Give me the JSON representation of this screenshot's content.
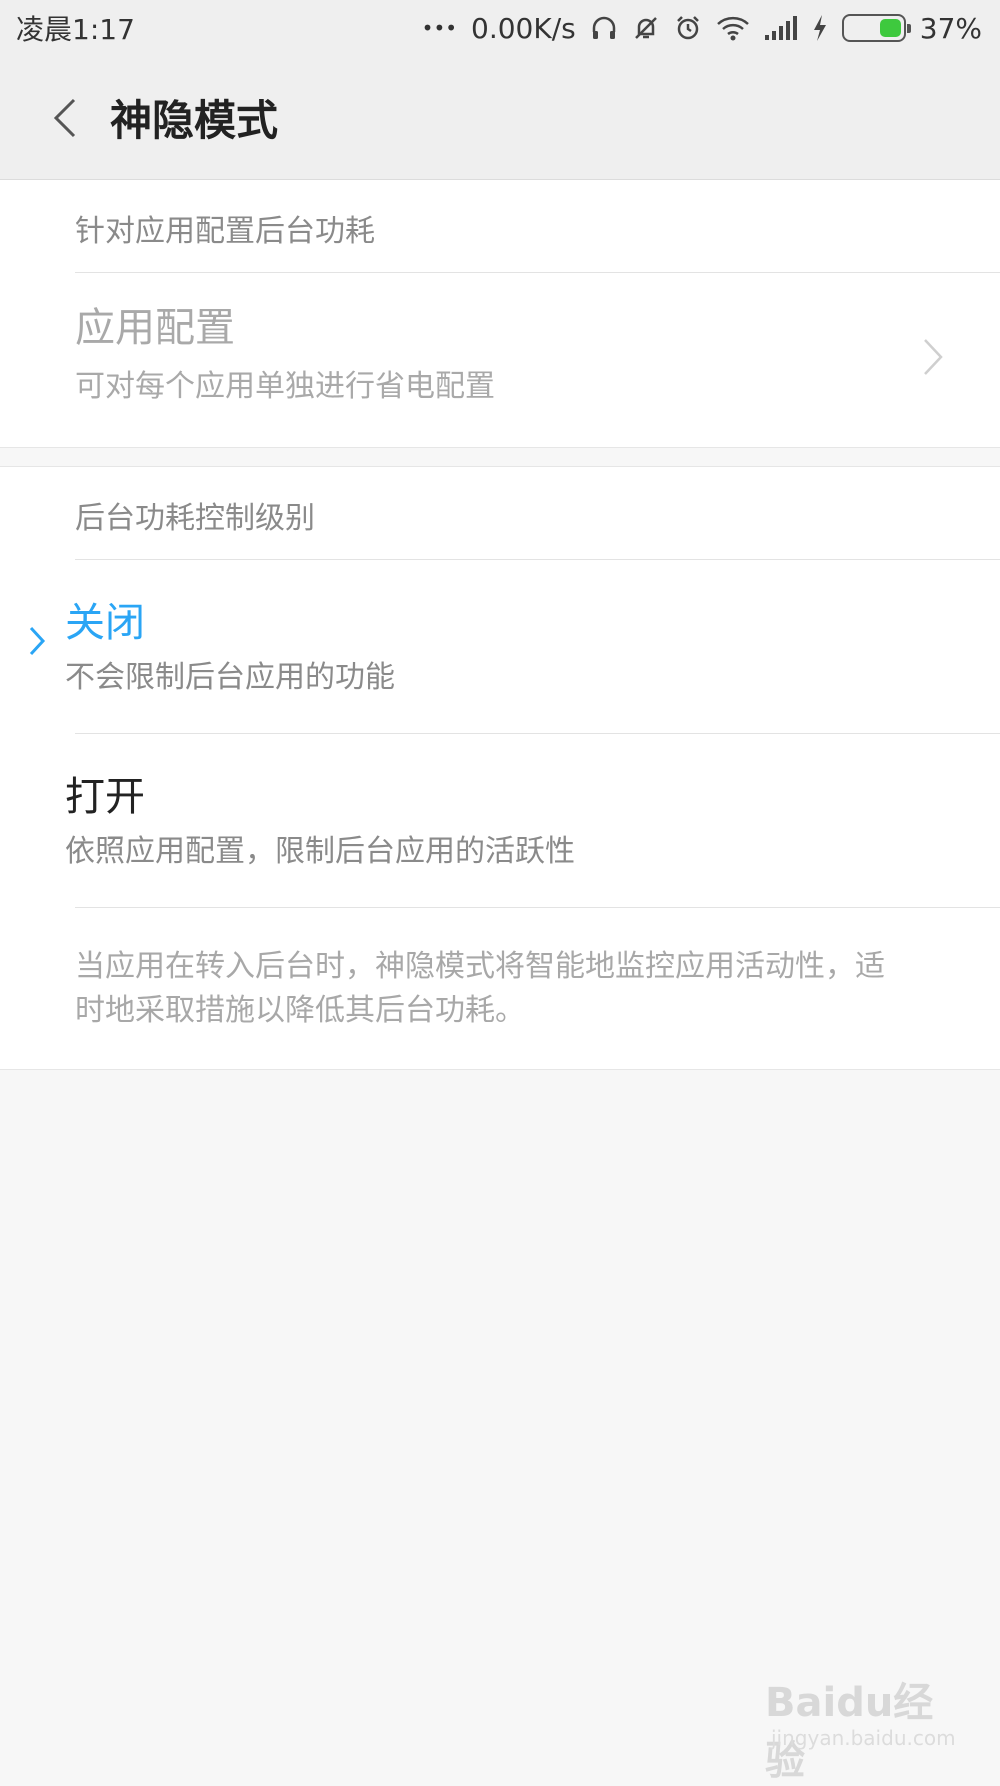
{
  "status_bar": {
    "time": "凌晨1:17",
    "dots": "•••",
    "net_speed": "0.00K/s",
    "battery_level": 0.37,
    "battery_percent": "37%",
    "battery_color": "#3ec93e",
    "icons": [
      "headphones-icon",
      "bell-muted-icon",
      "alarm-icon",
      "wifi-icon",
      "signal-icon",
      "charging-icon",
      "battery-icon"
    ]
  },
  "title_bar": {
    "title": "神隐模式",
    "back_icon": "chevron-left-icon"
  },
  "app_config_section": {
    "header": "针对应用配置后台功耗",
    "item": {
      "title": "应用配置",
      "subtitle": "可对每个应用单独进行省电配置",
      "icon": "chevron-right-icon"
    }
  },
  "level_section": {
    "header": "后台功耗控制级别",
    "options": [
      {
        "title": "关闭",
        "subtitle": "不会限制后台应用的功能",
        "selected": true
      },
      {
        "title": "打开",
        "subtitle": "依照应用配置，限制后台应用的活跃性",
        "selected": false
      }
    ],
    "note": "当应用在转入后台时，神隐模式将智能地监控应用活动性，适时地采取措施以降低其后台功耗。"
  },
  "watermark": {
    "brand": "Baidu经验",
    "url": "jingyan.baidu.com"
  },
  "colors": {
    "accent": "#2aa5f5",
    "background": "#f7f7f7",
    "card": "#ffffff",
    "secondary_text": "#8a8a8a"
  }
}
